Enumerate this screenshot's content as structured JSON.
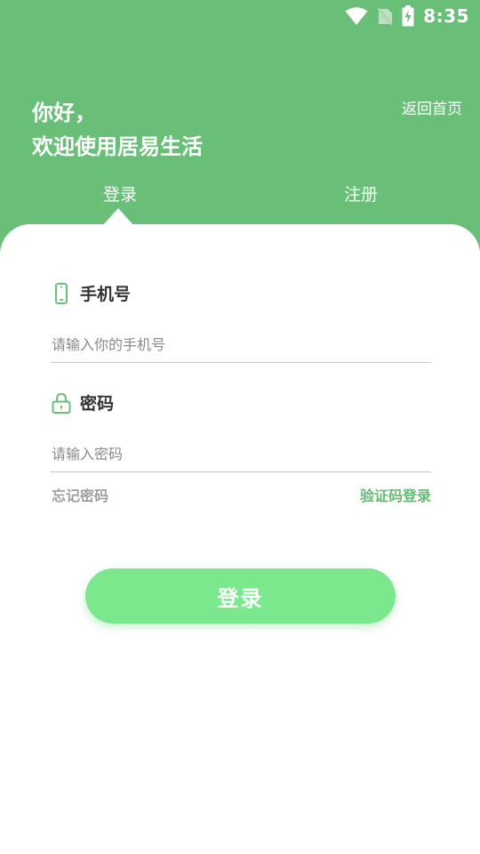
{
  "status_bar": {
    "time": "8:35",
    "icons": [
      "wifi-icon",
      "no-sim-icon",
      "battery-charging-icon"
    ]
  },
  "header": {
    "greeting_line1": "你好，",
    "greeting_line2": "欢迎使用居易生活",
    "back_home": "返回首页"
  },
  "tabs": [
    {
      "label": "登录",
      "active": true
    },
    {
      "label": "注册",
      "active": false
    }
  ],
  "form": {
    "phone": {
      "label": "手机号",
      "icon": "phone-icon",
      "placeholder": "请输入你的手机号",
      "value": ""
    },
    "password": {
      "label": "密码",
      "icon": "lock-icon",
      "placeholder": "请输入密码",
      "value": ""
    },
    "forgot_password": "忘记密码",
    "sms_login": "验证码登录",
    "submit_label": "登录"
  },
  "colors": {
    "header_bg": "#6abf78",
    "accent_text": "#63bb73",
    "button_bg": "#7ce88d",
    "muted_text": "#9e9e9e"
  }
}
